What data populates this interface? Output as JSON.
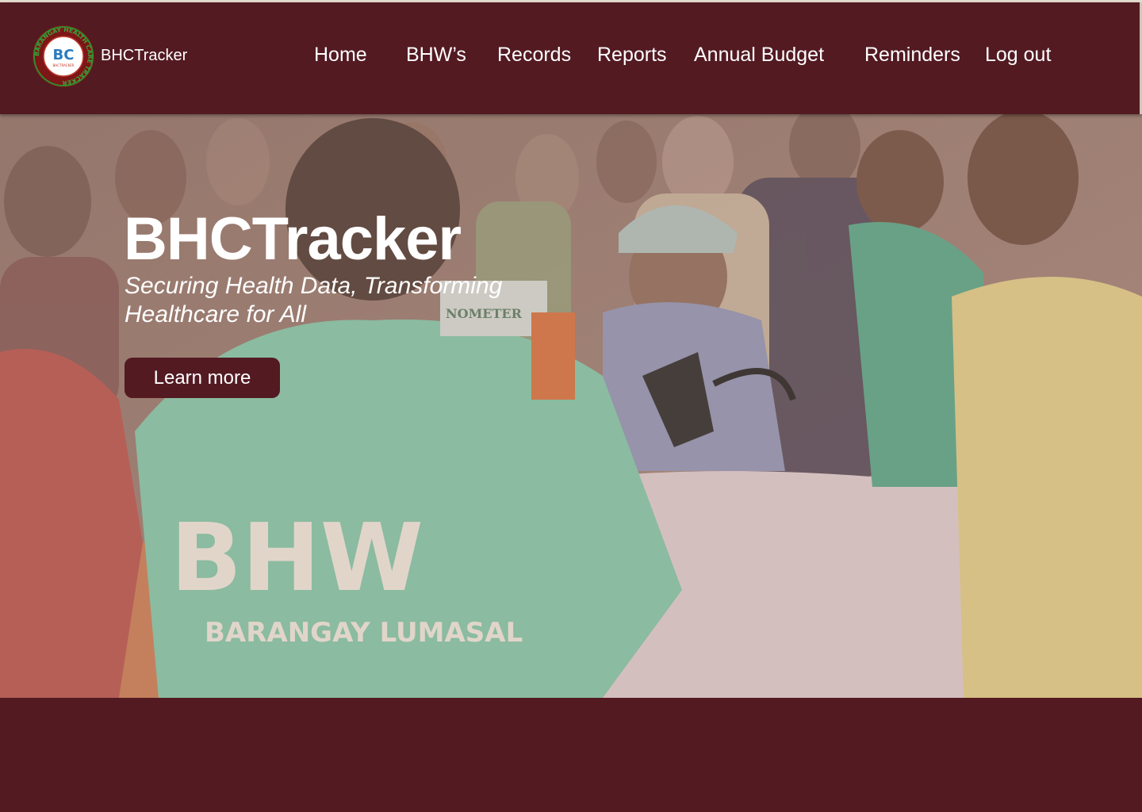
{
  "brand": {
    "name": "BHCTracker",
    "logo_ring_text": "BARANGAY HEALTH CARE TRACKER",
    "logo_monogram": "BC",
    "logo_caption": "BHCTRACKER"
  },
  "nav": {
    "items": [
      {
        "label": "Home"
      },
      {
        "label": "BHW’s"
      },
      {
        "label": "Records"
      },
      {
        "label": "Reports"
      },
      {
        "label": "Annual Budget"
      },
      {
        "label": "Reminders"
      },
      {
        "label": "Log out"
      }
    ]
  },
  "hero": {
    "title": "BHCTracker",
    "subtitle": "Securing Health Data, Transforming Healthcare for All",
    "cta_label": "Learn more",
    "photo_shirt_text": "BHW",
    "photo_shirt_subtext": "BARANGAY LUMASAL",
    "photo_box_text": "NOMETER"
  },
  "colors": {
    "primary": "#531a22",
    "text_on_primary": "#ffffff"
  }
}
